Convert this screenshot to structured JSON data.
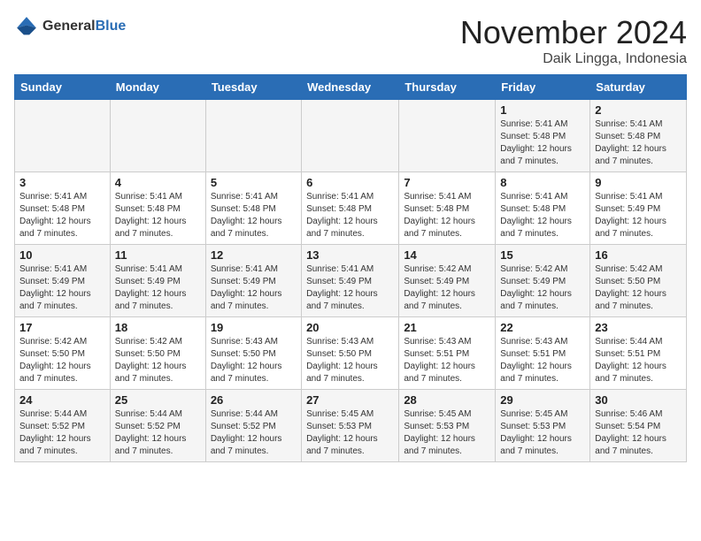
{
  "logo": {
    "general": "General",
    "blue": "Blue"
  },
  "title": "November 2024",
  "location": "Daik Lingga, Indonesia",
  "headers": [
    "Sunday",
    "Monday",
    "Tuesday",
    "Wednesday",
    "Thursday",
    "Friday",
    "Saturday"
  ],
  "weeks": [
    [
      {
        "day": "",
        "detail": ""
      },
      {
        "day": "",
        "detail": ""
      },
      {
        "day": "",
        "detail": ""
      },
      {
        "day": "",
        "detail": ""
      },
      {
        "day": "",
        "detail": ""
      },
      {
        "day": "1",
        "detail": "Sunrise: 5:41 AM\nSunset: 5:48 PM\nDaylight: 12 hours\nand 7 minutes."
      },
      {
        "day": "2",
        "detail": "Sunrise: 5:41 AM\nSunset: 5:48 PM\nDaylight: 12 hours\nand 7 minutes."
      }
    ],
    [
      {
        "day": "3",
        "detail": "Sunrise: 5:41 AM\nSunset: 5:48 PM\nDaylight: 12 hours\nand 7 minutes."
      },
      {
        "day": "4",
        "detail": "Sunrise: 5:41 AM\nSunset: 5:48 PM\nDaylight: 12 hours\nand 7 minutes."
      },
      {
        "day": "5",
        "detail": "Sunrise: 5:41 AM\nSunset: 5:48 PM\nDaylight: 12 hours\nand 7 minutes."
      },
      {
        "day": "6",
        "detail": "Sunrise: 5:41 AM\nSunset: 5:48 PM\nDaylight: 12 hours\nand 7 minutes."
      },
      {
        "day": "7",
        "detail": "Sunrise: 5:41 AM\nSunset: 5:48 PM\nDaylight: 12 hours\nand 7 minutes."
      },
      {
        "day": "8",
        "detail": "Sunrise: 5:41 AM\nSunset: 5:48 PM\nDaylight: 12 hours\nand 7 minutes."
      },
      {
        "day": "9",
        "detail": "Sunrise: 5:41 AM\nSunset: 5:49 PM\nDaylight: 12 hours\nand 7 minutes."
      }
    ],
    [
      {
        "day": "10",
        "detail": "Sunrise: 5:41 AM\nSunset: 5:49 PM\nDaylight: 12 hours\nand 7 minutes."
      },
      {
        "day": "11",
        "detail": "Sunrise: 5:41 AM\nSunset: 5:49 PM\nDaylight: 12 hours\nand 7 minutes."
      },
      {
        "day": "12",
        "detail": "Sunrise: 5:41 AM\nSunset: 5:49 PM\nDaylight: 12 hours\nand 7 minutes."
      },
      {
        "day": "13",
        "detail": "Sunrise: 5:41 AM\nSunset: 5:49 PM\nDaylight: 12 hours\nand 7 minutes."
      },
      {
        "day": "14",
        "detail": "Sunrise: 5:42 AM\nSunset: 5:49 PM\nDaylight: 12 hours\nand 7 minutes."
      },
      {
        "day": "15",
        "detail": "Sunrise: 5:42 AM\nSunset: 5:49 PM\nDaylight: 12 hours\nand 7 minutes."
      },
      {
        "day": "16",
        "detail": "Sunrise: 5:42 AM\nSunset: 5:50 PM\nDaylight: 12 hours\nand 7 minutes."
      }
    ],
    [
      {
        "day": "17",
        "detail": "Sunrise: 5:42 AM\nSunset: 5:50 PM\nDaylight: 12 hours\nand 7 minutes."
      },
      {
        "day": "18",
        "detail": "Sunrise: 5:42 AM\nSunset: 5:50 PM\nDaylight: 12 hours\nand 7 minutes."
      },
      {
        "day": "19",
        "detail": "Sunrise: 5:43 AM\nSunset: 5:50 PM\nDaylight: 12 hours\nand 7 minutes."
      },
      {
        "day": "20",
        "detail": "Sunrise: 5:43 AM\nSunset: 5:50 PM\nDaylight: 12 hours\nand 7 minutes."
      },
      {
        "day": "21",
        "detail": "Sunrise: 5:43 AM\nSunset: 5:51 PM\nDaylight: 12 hours\nand 7 minutes."
      },
      {
        "day": "22",
        "detail": "Sunrise: 5:43 AM\nSunset: 5:51 PM\nDaylight: 12 hours\nand 7 minutes."
      },
      {
        "day": "23",
        "detail": "Sunrise: 5:44 AM\nSunset: 5:51 PM\nDaylight: 12 hours\nand 7 minutes."
      }
    ],
    [
      {
        "day": "24",
        "detail": "Sunrise: 5:44 AM\nSunset: 5:52 PM\nDaylight: 12 hours\nand 7 minutes."
      },
      {
        "day": "25",
        "detail": "Sunrise: 5:44 AM\nSunset: 5:52 PM\nDaylight: 12 hours\nand 7 minutes."
      },
      {
        "day": "26",
        "detail": "Sunrise: 5:44 AM\nSunset: 5:52 PM\nDaylight: 12 hours\nand 7 minutes."
      },
      {
        "day": "27",
        "detail": "Sunrise: 5:45 AM\nSunset: 5:53 PM\nDaylight: 12 hours\nand 7 minutes."
      },
      {
        "day": "28",
        "detail": "Sunrise: 5:45 AM\nSunset: 5:53 PM\nDaylight: 12 hours\nand 7 minutes."
      },
      {
        "day": "29",
        "detail": "Sunrise: 5:45 AM\nSunset: 5:53 PM\nDaylight: 12 hours\nand 7 minutes."
      },
      {
        "day": "30",
        "detail": "Sunrise: 5:46 AM\nSunset: 5:54 PM\nDaylight: 12 hours\nand 7 minutes."
      }
    ]
  ]
}
